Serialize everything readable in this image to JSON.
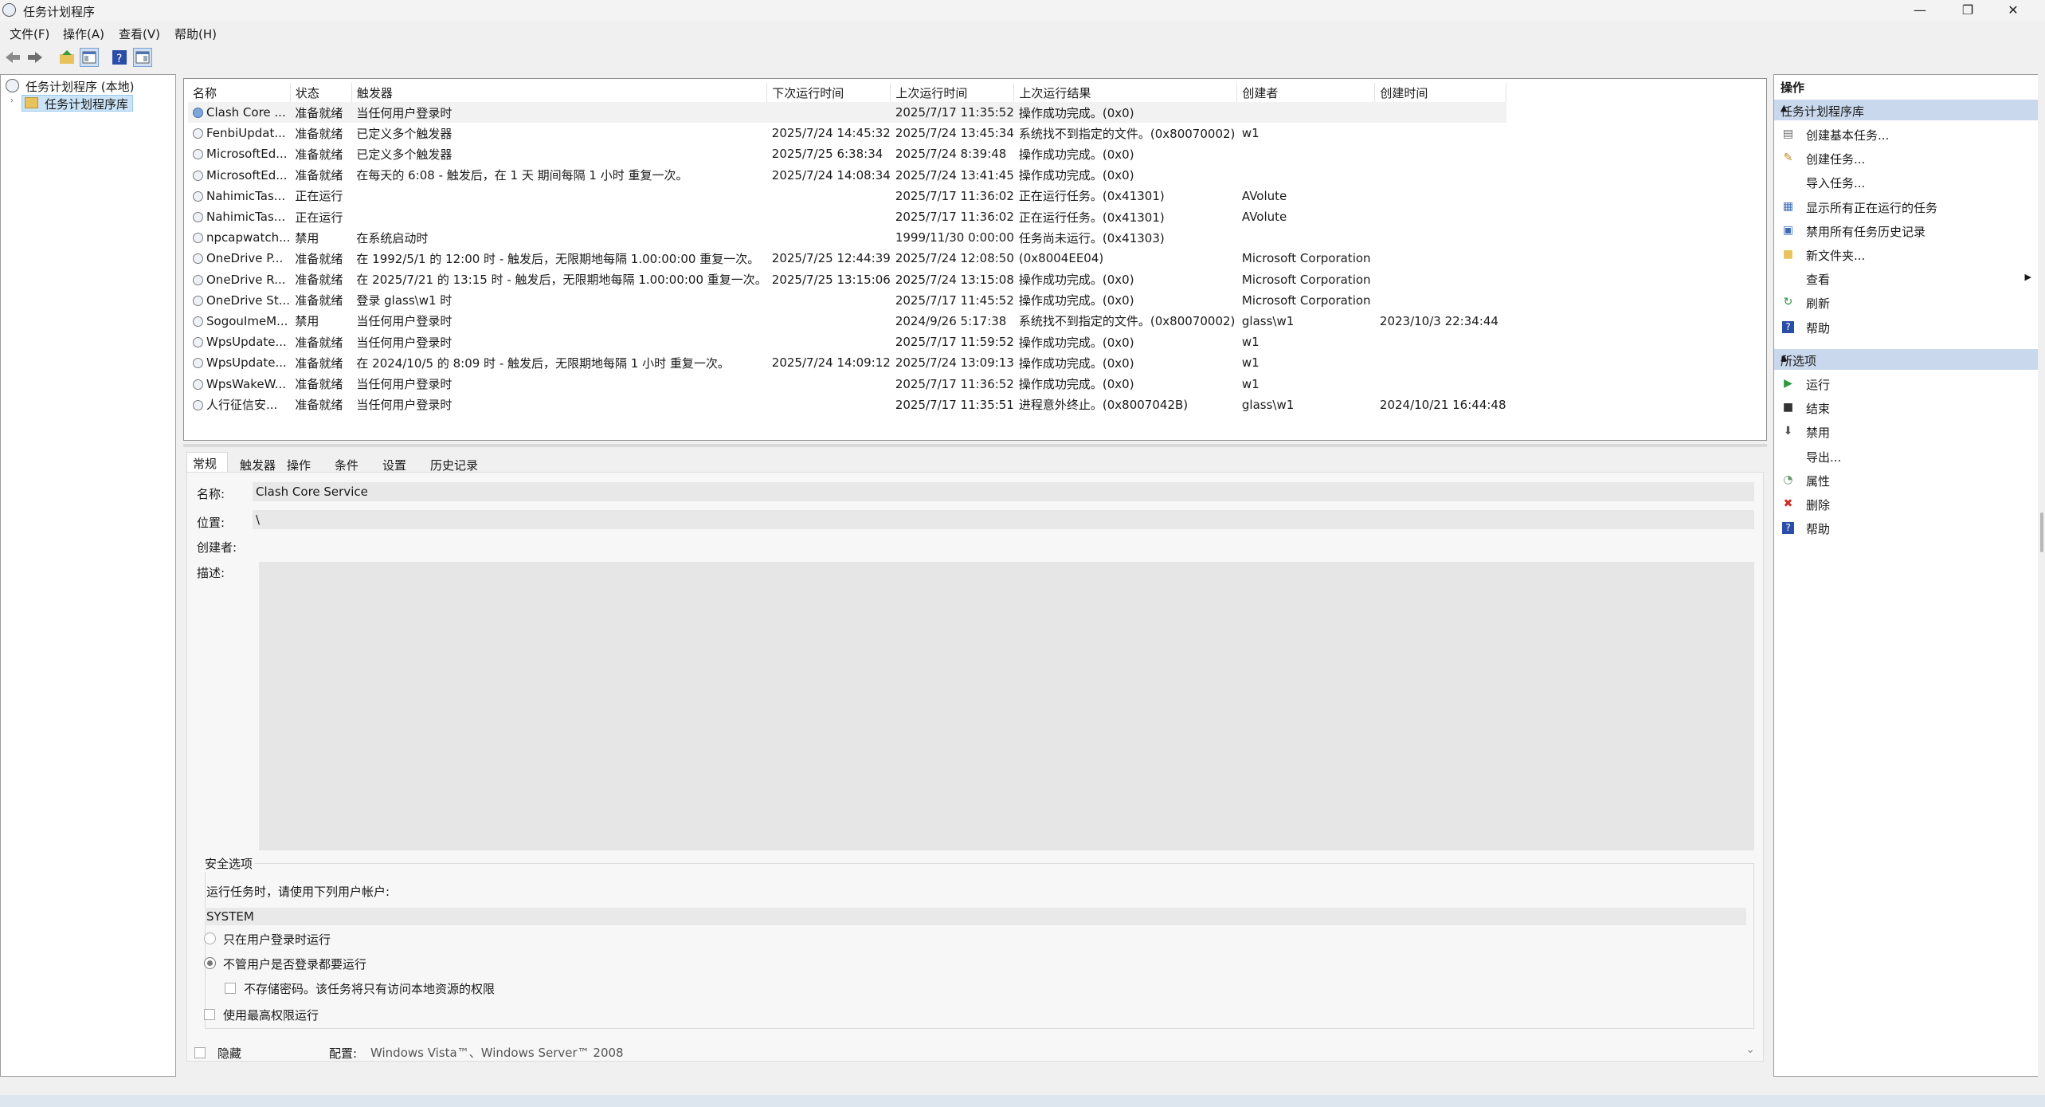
{
  "window": {
    "title": "任务计划程序",
    "min": "—",
    "restore": "❐",
    "close": "✕"
  },
  "menu": [
    "文件(F)",
    "操作(A)",
    "查看(V)",
    "帮助(H)"
  ],
  "tree": {
    "root": "任务计划程序 (本地)",
    "library": "任务计划程序库"
  },
  "tasks": {
    "columns": [
      "名称",
      "状态",
      "触发器",
      "下次运行时间",
      "上次运行时间",
      "上次运行结果",
      "创建者",
      "创建时间"
    ],
    "rows": [
      [
        "Clash Core ...",
        "准备就绪",
        "当任何用户登录时",
        "",
        "2025/7/17 11:35:52",
        "操作成功完成。(0x0)",
        "",
        ""
      ],
      [
        "FenbiUpdat...",
        "准备就绪",
        "已定义多个触发器",
        "2025/7/24 14:45:32",
        "2025/7/24 13:45:34",
        "系统找不到指定的文件。(0x80070002)",
        "w1",
        ""
      ],
      [
        "MicrosoftEd...",
        "准备就绪",
        "已定义多个触发器",
        "2025/7/25 6:38:34",
        "2025/7/24 8:39:48",
        "操作成功完成。(0x0)",
        "",
        ""
      ],
      [
        "MicrosoftEd...",
        "准备就绪",
        "在每天的 6:08 - 触发后，在 1 天 期间每隔 1 小时 重复一次。",
        "2025/7/24 14:08:34",
        "2025/7/24 13:41:45",
        "操作成功完成。(0x0)",
        "",
        ""
      ],
      [
        "NahimicTas...",
        "正在运行",
        "",
        "",
        "2025/7/17 11:36:02",
        "正在运行任务。(0x41301)",
        "AVolute",
        ""
      ],
      [
        "NahimicTas...",
        "正在运行",
        "",
        "",
        "2025/7/17 11:36:02",
        "正在运行任务。(0x41301)",
        "AVolute",
        ""
      ],
      [
        "npcapwatch...",
        "禁用",
        "在系统启动时",
        "",
        "1999/11/30 0:00:00",
        "任务尚未运行。(0x41303)",
        "",
        ""
      ],
      [
        "OneDrive P...",
        "准备就绪",
        "在 1992/5/1 的 12:00 时 - 触发后，无限期地每隔 1.00:00:00 重复一次。",
        "2025/7/25 12:44:39",
        "2025/7/24 12:08:50",
        "(0x8004EE04)",
        "Microsoft Corporation",
        ""
      ],
      [
        "OneDrive R...",
        "准备就绪",
        "在 2025/7/21 的 13:15 时 - 触发后，无限期地每隔 1.00:00:00 重复一次。",
        "2025/7/25 13:15:06",
        "2025/7/24 13:15:08",
        "操作成功完成。(0x0)",
        "Microsoft Corporation",
        ""
      ],
      [
        "OneDrive St...",
        "准备就绪",
        "登录 glass\\w1 时",
        "",
        "2025/7/17 11:45:52",
        "操作成功完成。(0x0)",
        "Microsoft Corporation",
        ""
      ],
      [
        "SogouImeM...",
        "禁用",
        "当任何用户登录时",
        "",
        "2024/9/26 5:17:38",
        "系统找不到指定的文件。(0x80070002)",
        "glass\\w1",
        "2023/10/3 22:34:44"
      ],
      [
        "WpsUpdate...",
        "准备就绪",
        "当任何用户登录时",
        "",
        "2025/7/17 11:59:52",
        "操作成功完成。(0x0)",
        "w1",
        ""
      ],
      [
        "WpsUpdate...",
        "准备就绪",
        "在 2024/10/5 的 8:09 时 - 触发后，无限期地每隔 1 小时 重复一次。",
        "2025/7/24 14:09:12",
        "2025/7/24 13:09:13",
        "操作成功完成。(0x0)",
        "w1",
        ""
      ],
      [
        "WpsWakeW...",
        "准备就绪",
        "当任何用户登录时",
        "",
        "2025/7/17 11:36:52",
        "操作成功完成。(0x0)",
        "w1",
        ""
      ],
      [
        "人行征信安...",
        "准备就绪",
        "当任何用户登录时",
        "",
        "2025/7/17 11:35:51",
        "进程意外终止。(0x8007042B)",
        "glass\\w1",
        "2024/10/21 16:44:48"
      ]
    ]
  },
  "detail": {
    "tabs": [
      "常规",
      "触发器",
      "操作",
      "条件",
      "设置",
      "历史记录"
    ],
    "name_label": "名称:",
    "name_value": "Clash Core Service",
    "location_label": "位置:",
    "location_value": "\\",
    "author_label": "创建者:",
    "author_value": "",
    "desc_label": "描述:",
    "security_title": "安全选项",
    "run_as_label": "运行任务时，请使用下列用户帐户:",
    "run_as_value": "SYSTEM",
    "opt_logged_on": "只在用户登录时运行",
    "opt_whether": "不管用户是否登录都要运行",
    "opt_no_password": "不存储密码。该任务将只有访问本地资源的权限",
    "opt_highest": "使用最高权限运行",
    "hidden_label": "隐藏",
    "config_label": "配置:",
    "config_value": "Windows Vista™、Windows Server™ 2008"
  },
  "actions": {
    "header": "操作",
    "section1": "任务计划程序库",
    "items1": [
      {
        "label": "创建基本任务...",
        "icon": "create-basic-task-icon"
      },
      {
        "label": "创建任务...",
        "icon": "create-task-icon"
      },
      {
        "label": "导入任务...",
        "icon": ""
      },
      {
        "label": "显示所有正在运行的任务",
        "icon": "running-tasks-icon"
      },
      {
        "label": "禁用所有任务历史记录",
        "icon": "history-icon"
      },
      {
        "label": "新文件夹...",
        "icon": "folder-icon"
      },
      {
        "label": "查看",
        "icon": ""
      },
      {
        "label": "刷新",
        "icon": "refresh-icon"
      },
      {
        "label": "帮助",
        "icon": "help-icon"
      }
    ],
    "section2": "所选项",
    "items2": [
      {
        "label": "运行",
        "icon": "run-icon"
      },
      {
        "label": "结束",
        "icon": "end-icon"
      },
      {
        "label": "禁用",
        "icon": "disable-icon"
      },
      {
        "label": "导出...",
        "icon": ""
      },
      {
        "label": "属性",
        "icon": "properties-icon"
      },
      {
        "label": "删除",
        "icon": "delete-icon"
      },
      {
        "label": "帮助",
        "icon": "help-icon"
      }
    ]
  }
}
